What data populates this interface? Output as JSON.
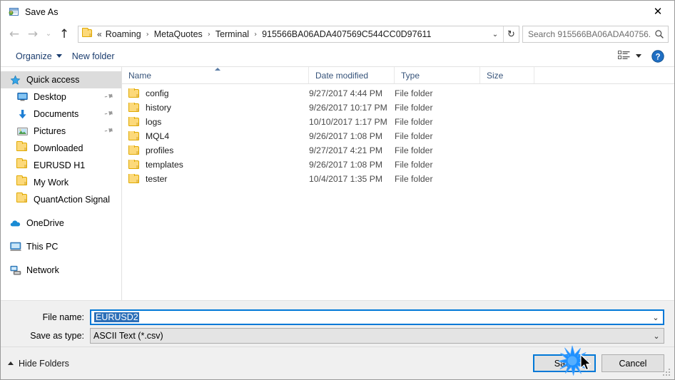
{
  "window": {
    "title": "Save As",
    "icon": "save-as-app-icon",
    "close_label": "✕"
  },
  "nav": {
    "back_icon": "back-arrow-icon",
    "forward_icon": "forward-arrow-icon",
    "recent_icon": "recent-locations-chevron-icon",
    "up_icon": "up-arrow-icon",
    "back_glyph": "←",
    "forward_glyph": "→",
    "recent_glyph": "⌄",
    "up_glyph": "↑",
    "address": {
      "folder_icon": "folder-icon",
      "overflow": "«",
      "separator": "›",
      "crumbs": [
        "Roaming",
        "MetaQuotes",
        "Terminal",
        "915566BA06ADA407569C544CC0D97611"
      ],
      "dropdown_glyph": "⌄",
      "refresh_glyph": "↻"
    },
    "search": {
      "placeholder": "Search 915566BA06ADA40756...",
      "icon": "search-icon"
    }
  },
  "commandbar": {
    "organize": "Organize",
    "new_folder": "New folder",
    "view_icon": "list-view-icon",
    "view_caret_icon": "chevron-down-icon",
    "help_icon": "help-icon",
    "help_glyph": "?"
  },
  "sidebar": {
    "items": [
      {
        "label": "Quick access",
        "icon": "star-icon",
        "selected": true,
        "pinned": false,
        "indent": "root"
      },
      {
        "label": "Desktop",
        "icon": "desktop-icon",
        "selected": false,
        "pinned": true,
        "indent": "child"
      },
      {
        "label": "Documents",
        "icon": "documents-download-icon",
        "selected": false,
        "pinned": true,
        "indent": "child"
      },
      {
        "label": "Pictures",
        "icon": "pictures-icon",
        "selected": false,
        "pinned": true,
        "indent": "child"
      },
      {
        "label": "Downloaded",
        "icon": "folder-icon",
        "selected": false,
        "pinned": false,
        "indent": "child"
      },
      {
        "label": "EURUSD H1",
        "icon": "folder-icon",
        "selected": false,
        "pinned": false,
        "indent": "child"
      },
      {
        "label": "My Work",
        "icon": "folder-icon",
        "selected": false,
        "pinned": false,
        "indent": "child"
      },
      {
        "label": "QuantAction Signal",
        "icon": "folder-icon",
        "selected": false,
        "pinned": false,
        "indent": "child"
      },
      {
        "label": "OneDrive",
        "icon": "onedrive-cloud-icon",
        "selected": false,
        "pinned": false,
        "indent": "group"
      },
      {
        "label": "This PC",
        "icon": "this-pc-icon",
        "selected": false,
        "pinned": false,
        "indent": "group"
      },
      {
        "label": "Network",
        "icon": "network-icon",
        "selected": false,
        "pinned": false,
        "indent": "group"
      }
    ],
    "pin_glyph": "📌"
  },
  "filelist": {
    "columns": [
      "Name",
      "Date modified",
      "Type",
      "Size"
    ],
    "sort_column": "Name",
    "sort_direction": "ascending",
    "rows": [
      {
        "name": "config",
        "date": "9/27/2017 4:44 PM",
        "type": "File folder",
        "size": ""
      },
      {
        "name": "history",
        "date": "9/26/2017 10:17 PM",
        "type": "File folder",
        "size": ""
      },
      {
        "name": "logs",
        "date": "10/10/2017 1:17 PM",
        "type": "File folder",
        "size": ""
      },
      {
        "name": "MQL4",
        "date": "9/26/2017 1:08 PM",
        "type": "File folder",
        "size": ""
      },
      {
        "name": "profiles",
        "date": "9/27/2017 4:21 PM",
        "type": "File folder",
        "size": ""
      },
      {
        "name": "templates",
        "date": "9/26/2017 1:08 PM",
        "type": "File folder",
        "size": ""
      },
      {
        "name": "tester",
        "date": "10/4/2017 1:35 PM",
        "type": "File folder",
        "size": ""
      }
    ]
  },
  "form": {
    "filename_label": "File name:",
    "filename_value": "EURUSD2",
    "filename_selected": true,
    "savetype_label": "Save as type:",
    "savetype_value": "ASCII Text (*.csv)",
    "caret_glyph": "⌄"
  },
  "footer": {
    "hide_folders": "Hide Folders",
    "save": "Save",
    "cancel": "Cancel",
    "default_button": "Save"
  },
  "colors": {
    "accent": "#0078d7",
    "link": "#1a3c6e",
    "header_text": "#36537a",
    "selection": "#2c6fb8",
    "folder": "#fcd97a",
    "burst": "#1e90ff"
  },
  "pointer": {
    "click_indicator": "click-burst",
    "cursor": "mouse-cursor-arrow",
    "target": "Save"
  }
}
